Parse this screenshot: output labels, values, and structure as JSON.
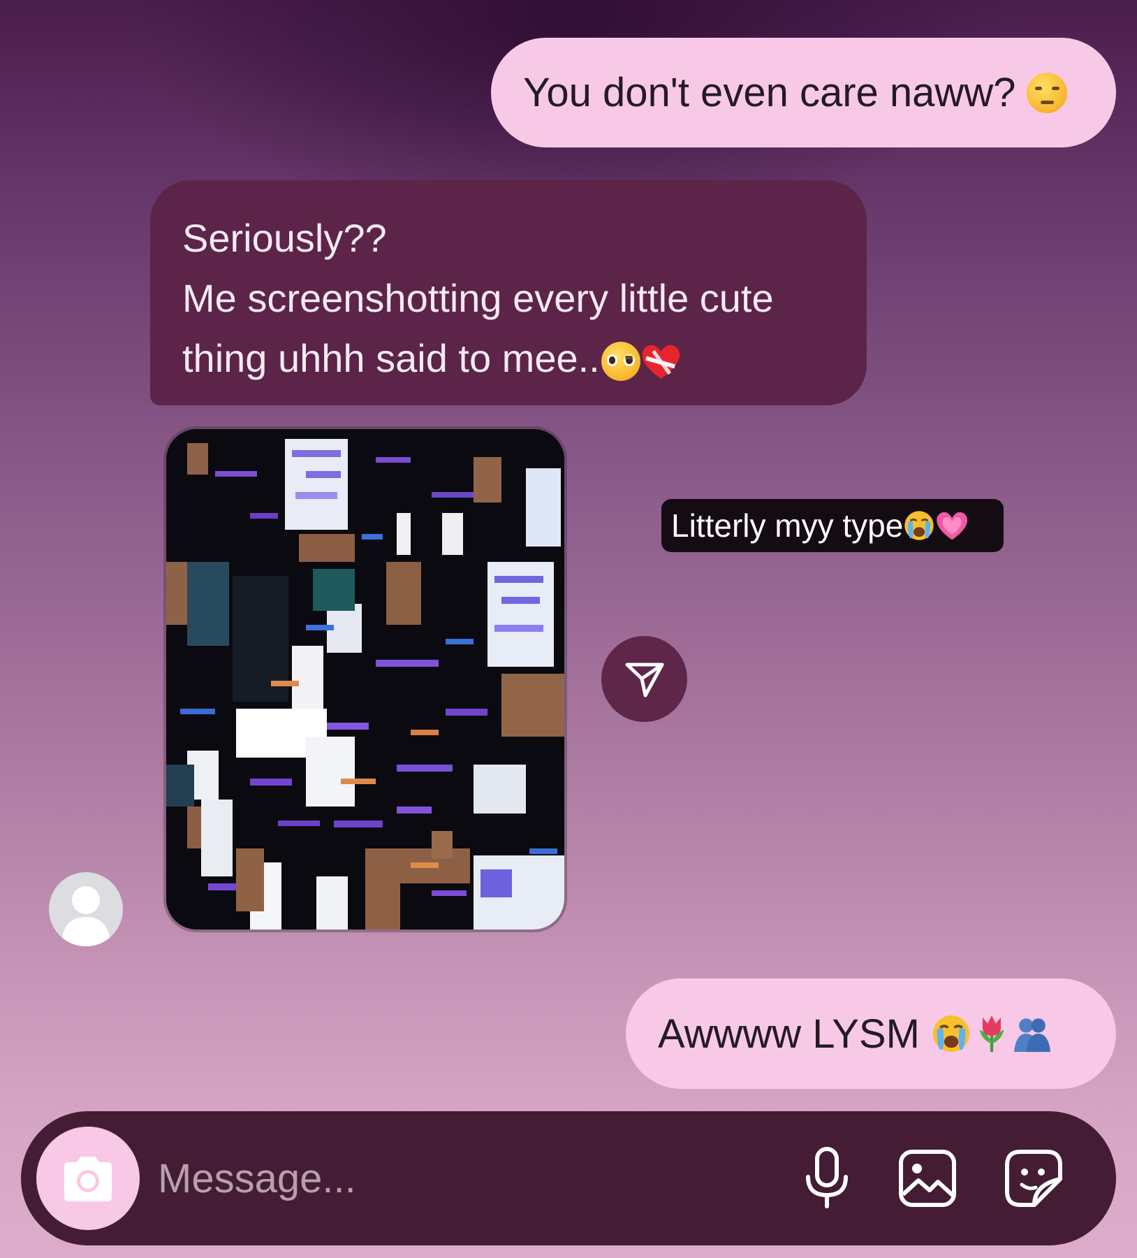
{
  "colors": {
    "outgoing_bubble": "#f8c9e6",
    "incoming_bubble": "#5c2448",
    "composer_bar": "#441c34",
    "accent_button": "#5e2648"
  },
  "messages": [
    {
      "direction": "outgoing",
      "text": "You don't even care naww?",
      "emojis": [
        "unamused-face"
      ]
    },
    {
      "direction": "incoming",
      "lines": [
        "Seriously??",
        "Me screenshotting every little cute",
        "thing uhhh said to mee.."
      ],
      "emojis": [
        "pleading-face",
        "mending-heart"
      ]
    },
    {
      "direction": "incoming",
      "type": "photo",
      "icon": "screenshot-collage-image"
    },
    {
      "direction": "overlay",
      "text": "Litterly myy type",
      "emojis": [
        "loudly-crying-face",
        "growing-heart"
      ]
    },
    {
      "direction": "outgoing",
      "text": "Awwww LYSM",
      "emojis": [
        "loudly-crying-face",
        "tulip",
        "people-hugging"
      ]
    }
  ],
  "share": {
    "icon": "send-icon"
  },
  "avatar": {
    "icon": "default-avatar-icon"
  },
  "composer": {
    "placeholder": "Message...",
    "value": "",
    "camera_icon": "camera-icon",
    "mic_icon": "microphone-icon",
    "gallery_icon": "image-icon",
    "sticker_icon": "sticker-icon"
  }
}
